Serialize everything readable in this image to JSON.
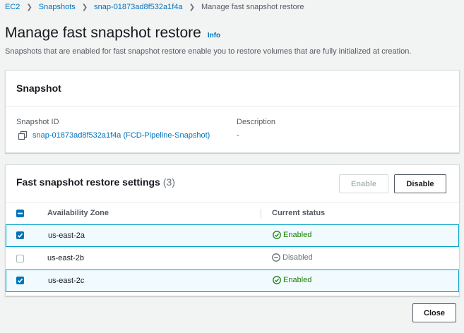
{
  "breadcrumb": {
    "items": [
      "EC2",
      "Snapshots",
      "snap-01873ad8f532a1f4a"
    ],
    "current": "Manage fast snapshot restore"
  },
  "page": {
    "title": "Manage fast snapshot restore",
    "info": "Info",
    "description": "Snapshots that are enabled for fast snapshot restore enable you to restore volumes that are fully initialized at creation."
  },
  "snapshot": {
    "header": "Snapshot",
    "id_label": "Snapshot ID",
    "id_value": "snap-01873ad8f532a1f4a (FCD-Pipeline-Snapshot)",
    "description_label": "Description",
    "description_value": "-"
  },
  "frs": {
    "title": "Fast snapshot restore settings",
    "count": "(3)",
    "enable_label": "Enable",
    "disable_label": "Disable",
    "columns": [
      "Availability Zone",
      "Current status"
    ],
    "header_checkbox": "indeterminate",
    "rows": [
      {
        "az": "us-east-2a",
        "status": "Enabled",
        "checked": true
      },
      {
        "az": "us-east-2b",
        "status": "Disabled",
        "checked": false
      },
      {
        "az": "us-east-2c",
        "status": "Enabled",
        "checked": true
      }
    ]
  },
  "footer": {
    "close_label": "Close"
  },
  "colors": {
    "link": "#0073bb",
    "enabled": "#1d8102",
    "disabled": "#687078",
    "selected_row_bg": "#f1faff",
    "selected_row_border": "#00a1c9"
  },
  "icons": {
    "copy": "copy-icon",
    "enabled": "status-positive-icon",
    "disabled": "status-stopped-icon"
  }
}
